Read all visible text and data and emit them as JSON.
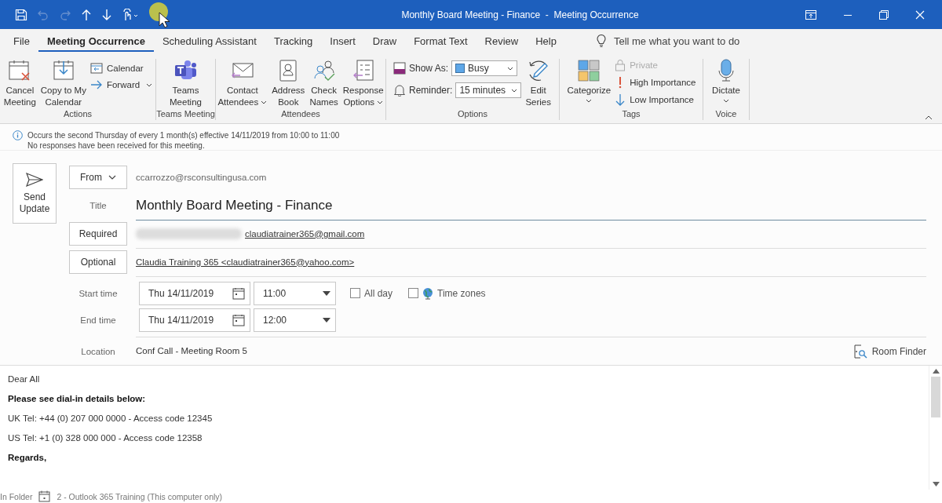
{
  "window": {
    "title": "Monthly Board Meeting - Finance  -  Meeting Occurrence"
  },
  "tabs": [
    {
      "label": "File",
      "selected": false
    },
    {
      "label": "Meeting Occurrence",
      "selected": true
    },
    {
      "label": "Scheduling Assistant",
      "selected": false
    },
    {
      "label": "Tracking",
      "selected": false
    },
    {
      "label": "Insert",
      "selected": false
    },
    {
      "label": "Draw",
      "selected": false
    },
    {
      "label": "Format Text",
      "selected": false
    },
    {
      "label": "Review",
      "selected": false
    },
    {
      "label": "Help",
      "selected": false
    }
  ],
  "tell_me": "Tell me what you want to do",
  "ribbon": {
    "actions": {
      "label": "Actions",
      "cancel": "Cancel\nMeeting",
      "copy": "Copy to My\nCalendar",
      "calendar": "Calendar",
      "forward": "Forward"
    },
    "teams": {
      "label": "Teams Meeting",
      "teams_meeting": "Teams\nMeeting"
    },
    "attendees": {
      "label": "Attendees",
      "contact": "Contact\nAttendees",
      "address_book": "Address\nBook",
      "check_names": "Check\nNames",
      "response": "Response\nOptions"
    },
    "options": {
      "label": "Options",
      "show_as_label": "Show As:",
      "show_as_value": "Busy",
      "reminder_label": "Reminder:",
      "reminder_value": "15 minutes",
      "edit_series": "Edit\nSeries"
    },
    "tags": {
      "label": "Tags",
      "categorize": "Categorize",
      "private": {
        "label": "Private",
        "disabled": true
      },
      "high": "High Importance",
      "low": "Low Importance"
    },
    "voice": {
      "label": "Voice",
      "dictate": "Dictate"
    }
  },
  "info": [
    "Occurs the second Thursday of every 1 month(s) effective 14/11/2019 from 10:00 to 11:00",
    "No responses have been received for this meeting."
  ],
  "send_button": "Send\nUpdate",
  "form": {
    "from_button": "From",
    "from_value": "ccarrozzo@rsconsultingusa.com",
    "title_label": "Title",
    "title_value": "Monthly Board Meeting - Finance",
    "required_button": "Required",
    "required_value": "claudiatrainer365@gmail.com",
    "optional_button": "Optional",
    "optional_value": "Claudia Training 365 <claudiatrainer365@yahoo.com>",
    "start_label": "Start time",
    "start_date": "Thu 14/11/2019",
    "start_time": "11:00",
    "all_day": {
      "label": "All day",
      "checked": false
    },
    "time_zones": {
      "label": "Time zones",
      "checked": false
    },
    "end_label": "End time",
    "end_date": "Thu 14/11/2019",
    "end_time": "12:00",
    "location_label": "Location",
    "location_value": "Conf Call - Meeting Room 5",
    "room_finder": "Room Finder"
  },
  "body": [
    {
      "text": "Dear All",
      "bold": false
    },
    {
      "text": "Please see dial-in details below:",
      "bold": true
    },
    {
      "text": "UK Tel: +44 (0) 207 000 0000 - Access code 12345",
      "bold": false
    },
    {
      "text": "US Tel: +1 (0) 328 000 000 - Access code 12358",
      "bold": false
    },
    {
      "text": "Regards,",
      "bold": true
    }
  ],
  "status_bar": {
    "label": "In Folder",
    "folder": "2 - Outlook 365 Training (This computer only)"
  }
}
